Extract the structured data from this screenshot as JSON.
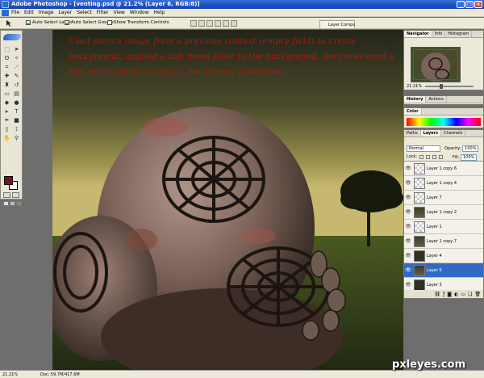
{
  "window": {
    "title": "Adobe Photoshop - [venting.psd @ 21.2% (Layer 6, RGB/8)]"
  },
  "menu": [
    "File",
    "Edit",
    "Image",
    "Layer",
    "Select",
    "Filter",
    "View",
    "Window",
    "Help"
  ],
  "options": {
    "auto_select_layer": "Auto Select Layer",
    "auto_select_groups": "Auto Select Groups",
    "show_transform_controls": "Show Transform Controls",
    "auto_select_layer_checked": true,
    "auto_select_groups_checked": true,
    "show_transform_checked": false,
    "layer_comps_tab": "Layer Comps"
  },
  "canvas": {
    "caption": "Used source image from a previous contest (empty field) to create background, applied a soft mood filter to the background, then overlayed a film grain source to give it the strange  coloration."
  },
  "panels": {
    "navigator_tabs": [
      "Navigator",
      "Info",
      "Histogram"
    ],
    "navigator_zoom": "21.21%",
    "history_tabs": [
      "History",
      "Actions"
    ],
    "color_tabs": [
      "Color"
    ],
    "layers_tabs": [
      "Paths",
      "Layers",
      "Channels"
    ],
    "blend_mode": "Normal",
    "opacity_label": "Opacity:",
    "opacity_value": "100%",
    "lock_label": "Lock:",
    "fill_label": "Fill:",
    "fill_value": "100%",
    "layers": [
      {
        "name": "Layer 1 copy 6",
        "thumb": "transparent",
        "selected": false
      },
      {
        "name": "Layer 1 copy 4",
        "thumb": "transparent",
        "selected": false
      },
      {
        "name": "Layer 7",
        "thumb": "transparent",
        "selected": false
      },
      {
        "name": "Layer 1 copy 2",
        "thumb": "photo",
        "selected": false
      },
      {
        "name": "Layer 1",
        "thumb": "transparent",
        "selected": false
      },
      {
        "name": "Layer 1 copy 7",
        "thumb": "photo",
        "selected": false
      },
      {
        "name": "Layer 4",
        "thumb": "dark",
        "selected": false
      },
      {
        "name": "Layer 6",
        "thumb": "photo",
        "selected": true
      },
      {
        "name": "Layer 3",
        "thumb": "dark",
        "selected": false
      }
    ]
  },
  "status": {
    "zoom": "21.21%",
    "doc": "Doc: 59.7M/417.6M"
  },
  "watermark": "pxleyes.com",
  "colors": {
    "foreground": "#7a1010",
    "background": "#ffffff",
    "caption": "#b01a10",
    "selection": "#316ac5"
  }
}
